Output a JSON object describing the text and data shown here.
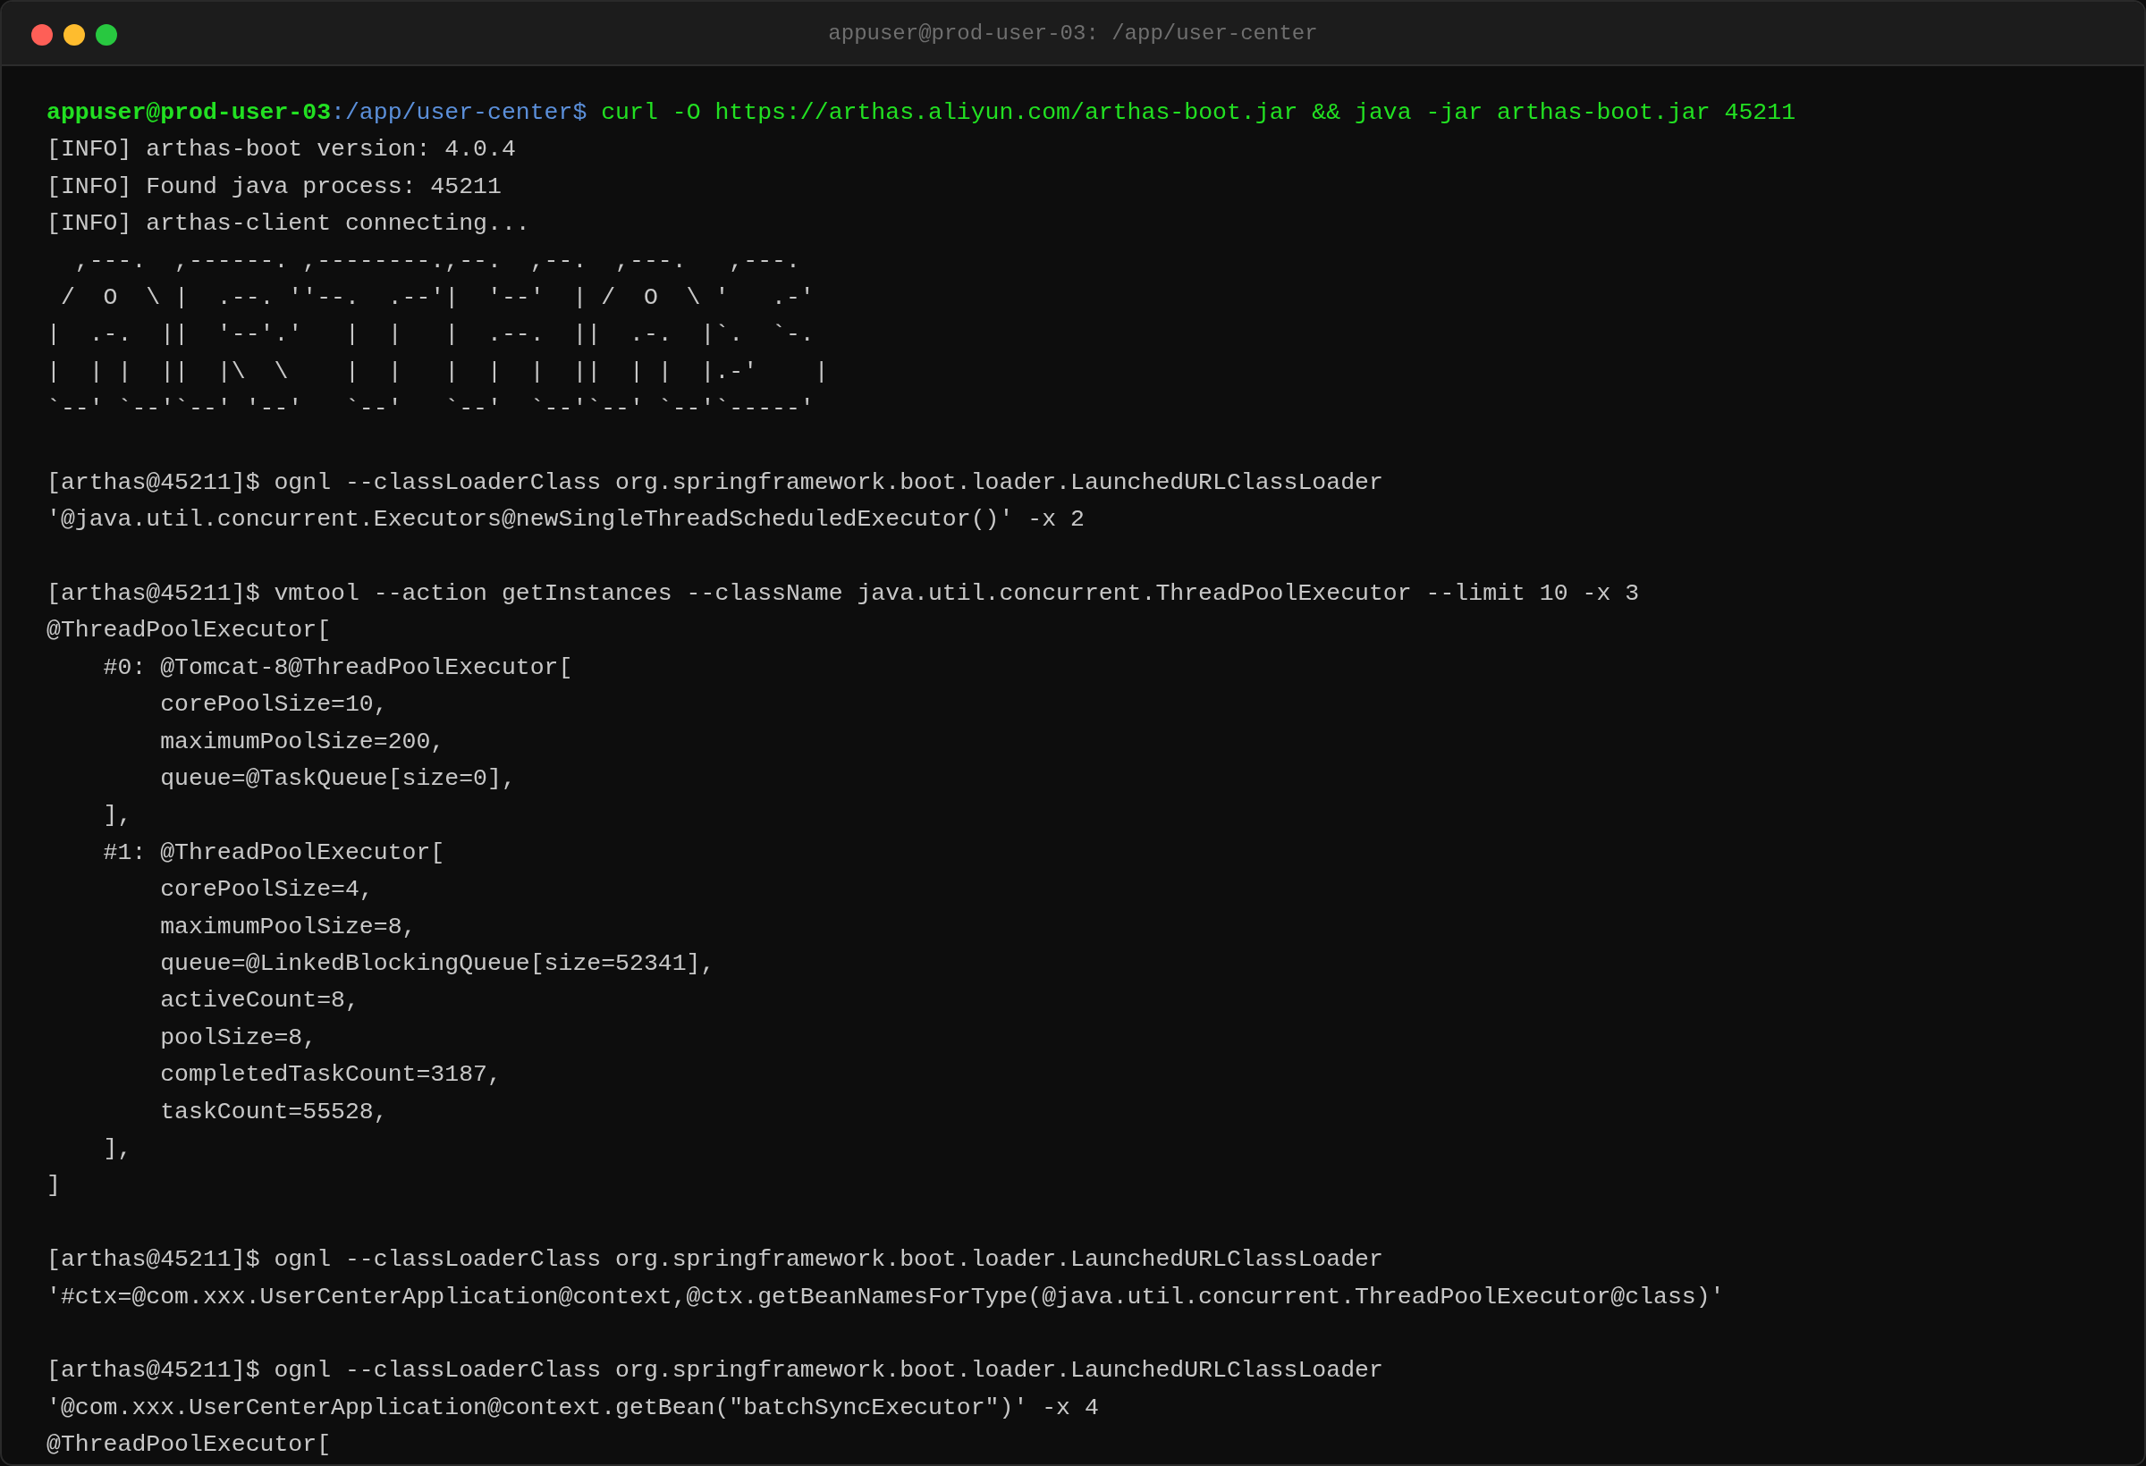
{
  "window": {
    "title": "appuser@prod-user-03: /app/user-center"
  },
  "lines": [
    {
      "kind": "prompt",
      "user": "appuser@prod-user-03",
      "path": ":/app/user-center$",
      "command": "curl -O https://arthas.aliyun.com/arthas-boot.jar && java -jar arthas-boot.jar 45211"
    },
    {
      "kind": "output",
      "text": "[INFO] arthas-boot version: 4.0.4"
    },
    {
      "kind": "output",
      "text": "[INFO] Found java process: 45211"
    },
    {
      "kind": "output",
      "text": "[INFO] arthas-client connecting..."
    },
    {
      "kind": "output",
      "text": "  ,---.  ,------. ,--------.,--.  ,--.  ,---.   ,---."
    },
    {
      "kind": "output",
      "text": " /  O  \\ |  .--. ''--.  .--'|  '--'  | /  O  \\ '   .-'"
    },
    {
      "kind": "output",
      "text": "|  .-.  ||  '--'.'   |  |   |  .--.  ||  .-.  |`.  `-."
    },
    {
      "kind": "output",
      "text": "|  | |  ||  |\\  \\    |  |   |  |  |  ||  | |  |.-'    |"
    },
    {
      "kind": "output",
      "text": "`--' `--'`--' '--'   `--'   `--'  `--'`--' `--'`-----'"
    },
    {
      "kind": "blank"
    },
    {
      "kind": "output",
      "text": "[arthas@45211]$ ognl --classLoaderClass org.springframework.boot.loader.LaunchedURLClassLoader"
    },
    {
      "kind": "output",
      "text": "'@java.util.concurrent.Executors@newSingleThreadScheduledExecutor()' -x 2"
    },
    {
      "kind": "blank"
    },
    {
      "kind": "output",
      "text": "[arthas@45211]$ vmtool --action getInstances --className java.util.concurrent.ThreadPoolExecutor --limit 10 -x 3"
    },
    {
      "kind": "output",
      "text": "@ThreadPoolExecutor["
    },
    {
      "kind": "output",
      "text": "    #0: @Tomcat-8@ThreadPoolExecutor["
    },
    {
      "kind": "output",
      "text": "        corePoolSize=10,"
    },
    {
      "kind": "output",
      "text": "        maximumPoolSize=200,"
    },
    {
      "kind": "output",
      "text": "        queue=@TaskQueue[size=0],"
    },
    {
      "kind": "output",
      "text": "    ],"
    },
    {
      "kind": "output",
      "text": "    #1: @ThreadPoolExecutor["
    },
    {
      "kind": "output",
      "text": "        corePoolSize=4,"
    },
    {
      "kind": "output",
      "text": "        maximumPoolSize=8,"
    },
    {
      "kind": "output",
      "text": "        queue=@LinkedBlockingQueue[size=52341],"
    },
    {
      "kind": "output",
      "text": "        activeCount=8,"
    },
    {
      "kind": "output",
      "text": "        poolSize=8,"
    },
    {
      "kind": "output",
      "text": "        completedTaskCount=3187,"
    },
    {
      "kind": "output",
      "text": "        taskCount=55528,"
    },
    {
      "kind": "output",
      "text": "    ],"
    },
    {
      "kind": "output",
      "text": "]"
    },
    {
      "kind": "blank"
    },
    {
      "kind": "output",
      "text": "[arthas@45211]$ ognl --classLoaderClass org.springframework.boot.loader.LaunchedURLClassLoader"
    },
    {
      "kind": "output",
      "text": "'#ctx=@com.xxx.UserCenterApplication@context,@ctx.getBeanNamesForType(@java.util.concurrent.ThreadPoolExecutor@class)'"
    },
    {
      "kind": "blank"
    },
    {
      "kind": "output",
      "text": "[arthas@45211]$ ognl --classLoaderClass org.springframework.boot.loader.LaunchedURLClassLoader"
    },
    {
      "kind": "output",
      "text": "'@com.xxx.UserCenterApplication@context.getBean(\"batchSyncExecutor\")' -x 4"
    },
    {
      "kind": "output",
      "text": "@ThreadPoolExecutor["
    }
  ]
}
